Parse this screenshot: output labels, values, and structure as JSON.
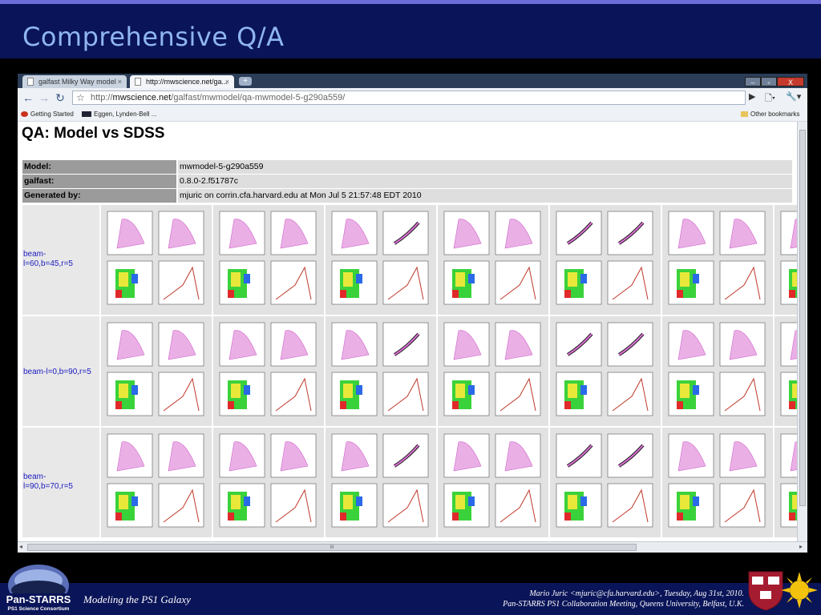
{
  "slide": {
    "title": "Comprehensive Q/A",
    "footer_left": "Modeling the PS1 Galaxy",
    "footer_right_line1": "Mario Juric <mjuric@cfa.harvard.edu>, Tuesday, Aug 31st, 2010.",
    "footer_right_line2": "Pan-STARRS PS1 Collaboration Meeting, Queens University, Belfast, U.K.",
    "logo_text_1": "Pan-STARRS",
    "logo_text_2": "PS1 Science Consortium",
    "colors": {
      "title_band": "#0a1458",
      "title_text": "#8fb6f2",
      "accent_stripe": "#6d6dd8"
    }
  },
  "browser": {
    "tabs": [
      {
        "label": "galfast Milky Way model",
        "active": false
      },
      {
        "label": "http://mwscience.net/ga...",
        "active": true
      }
    ],
    "new_tab_icon": "plus-icon",
    "window_buttons": {
      "minimize": "–",
      "maximize": "▫",
      "close": "X"
    },
    "url_prefix": "http://",
    "url_host": "mwscience.net",
    "url_path": "/galfast/mwmodel/qa-mwmodel-5-g290a559/",
    "bookmarks": [
      {
        "label": "Getting Started",
        "icon": "firefox-icon"
      },
      {
        "label": "Eggen, Lynden-Bell ...",
        "icon": "ads-icon"
      }
    ],
    "other_bookmarks": "Other bookmarks",
    "scrollbar_grip": "III"
  },
  "page": {
    "heading": "QA: Model vs SDSS",
    "meta": [
      {
        "key": "Model:",
        "value": "mwmodel-5-g290a559"
      },
      {
        "key": "galfast:",
        "value": "0.8.0-2.f51787c"
      },
      {
        "key": "Generated by:",
        "value": "mjuric on corrin.cfa.harvard.edu at Mon Jul 5 21:57:48 EDT 2010"
      }
    ],
    "rows": [
      {
        "label_lines": [
          "beam-",
          "l=60,b=45,r=5"
        ]
      },
      {
        "label_lines": [
          "beam-l=0,b=90,r=5",
          ""
        ]
      },
      {
        "label_lines": [
          "beam-",
          "l=90,b=70,r=5"
        ]
      }
    ]
  }
}
